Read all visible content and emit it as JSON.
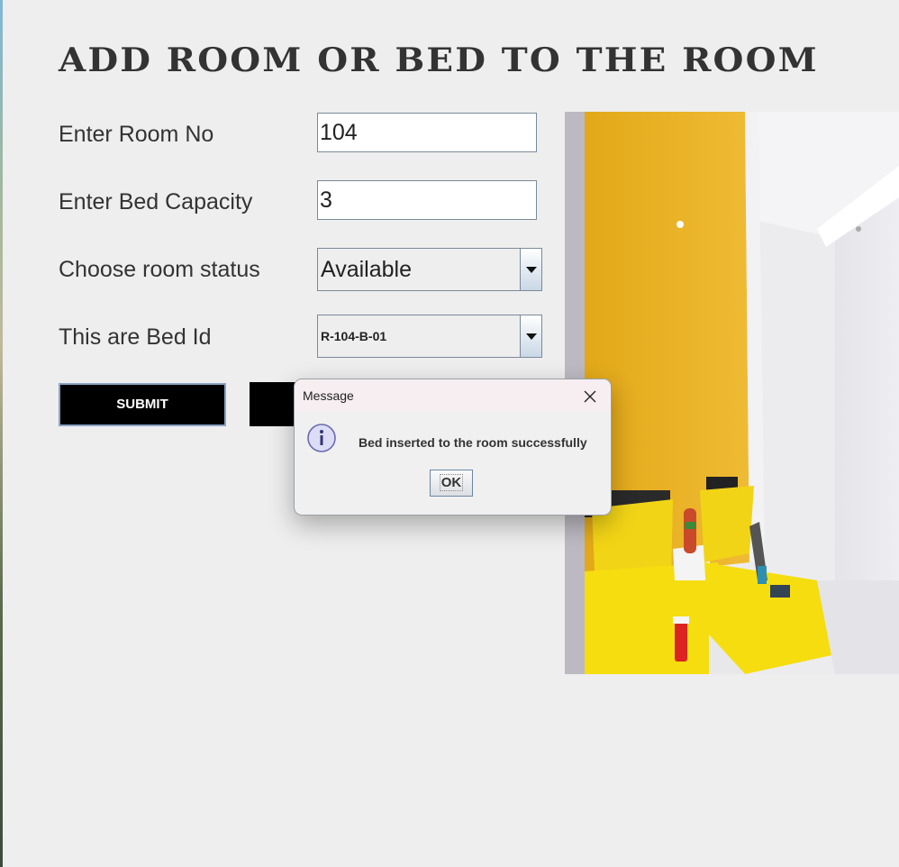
{
  "page": {
    "title": "ADD ROOM OR BED TO THE ROOM"
  },
  "form": {
    "room_no": {
      "label": "Enter Room No",
      "value": "104"
    },
    "bed_capacity": {
      "label": "Enter Bed Capacity",
      "value": "3"
    },
    "room_status": {
      "label": "Choose room status",
      "selected": "Available"
    },
    "bed_id": {
      "label": "This are Bed Id",
      "selected": "R-104-B-01"
    },
    "submit_label": "SUBMIT"
  },
  "dialog": {
    "title": "Message",
    "message": "Bed inserted to the room successfully",
    "ok_label": "OK",
    "icon": "info-icon"
  },
  "colors": {
    "background": "#eeeeee",
    "button": "#000000",
    "wall_accent": "#e9b21f",
    "bedding": "#f1d800"
  }
}
